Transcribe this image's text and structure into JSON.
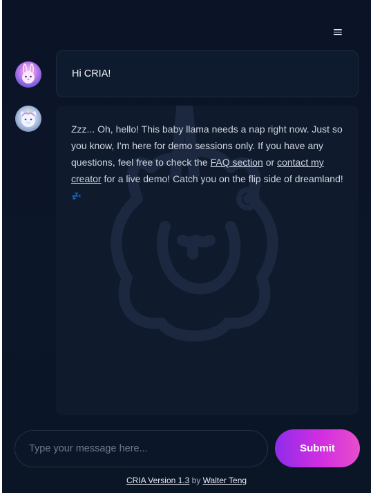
{
  "header": {
    "menu_icon": "hamburger-menu-icon"
  },
  "conversation": {
    "user_message": {
      "avatar": "bunny-avatar",
      "text": "Hi CRIA!"
    },
    "bot_message": {
      "avatar": "unicorn-llama-avatar",
      "watermark_icon": "llama-unicorn-logo",
      "text_part1": "Zzz... Oh, hello! This baby llama needs a nap right now. Just so you know, I'm here for demo sessions only. If you have any questions, feel free to check the ",
      "faq_link": "FAQ section",
      "text_part2": " or ",
      "creator_link": "contact my creator",
      "text_part3": " for a live demo! Catch you on the flip side of dreamland! ",
      "zzz_emoji": "💤"
    }
  },
  "composer": {
    "placeholder": "Type your message here...",
    "value": "",
    "submit_label": "Submit"
  },
  "footer": {
    "version_link": "CRIA Version 1.3",
    "by_text": " by ",
    "author_link": "Walter Teng"
  },
  "colors": {
    "background": "#0b1426",
    "bubble": "#0f1a2c",
    "submit_gradient_start": "#8e2cea",
    "submit_gradient_end": "#e74ecb"
  }
}
